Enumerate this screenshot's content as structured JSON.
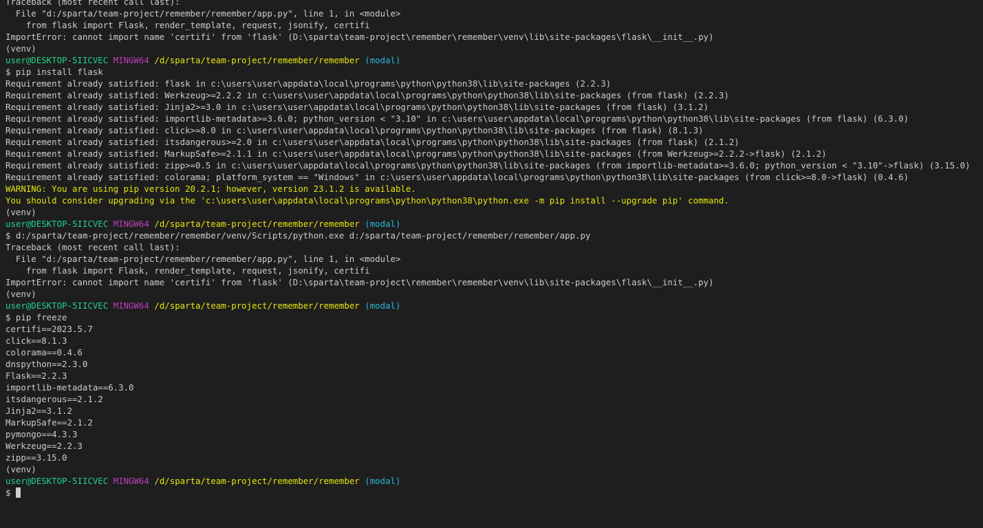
{
  "colors": {
    "background": "#1e1e1e",
    "text": "#cccccc",
    "user_host": "#23d18b",
    "shell_name": "#bc3fbc",
    "cwd": "#e5e510",
    "branch": "#29b8db",
    "warning": "#e5e510"
  },
  "lines": [
    [
      {
        "t": "Traceback (most recent call last):",
        "c": "default"
      }
    ],
    [
      {
        "t": "  File \"d:/sparta/team-project/remember/remember/app.py\", line 1, in <module>",
        "c": "default"
      }
    ],
    [
      {
        "t": "    from flask import Flask, render_template, request, jsonify, certifi",
        "c": "default"
      }
    ],
    [
      {
        "t": "ImportError: cannot import name 'certifi' from 'flask' (D:\\sparta\\team-project\\remember\\remember\\venv\\lib\\site-packages\\flask\\__init__.py)",
        "c": "default"
      }
    ],
    [
      {
        "t": "(venv)",
        "c": "default"
      }
    ],
    [
      {
        "t": "user@DESKTOP-5IICVEC",
        "c": "user"
      },
      {
        "t": " ",
        "c": "default"
      },
      {
        "t": "MINGW64",
        "c": "mingw"
      },
      {
        "t": " ",
        "c": "default"
      },
      {
        "t": "/d/sparta/team-project/remember/remember",
        "c": "path"
      },
      {
        "t": " ",
        "c": "default"
      },
      {
        "t": "(modal)",
        "c": "branch"
      }
    ],
    [
      {
        "t": "$ pip install flask",
        "c": "default"
      }
    ],
    [
      {
        "t": "Requirement already satisfied: flask in c:\\users\\user\\appdata\\local\\programs\\python\\python38\\lib\\site-packages (2.2.3)",
        "c": "default"
      }
    ],
    [
      {
        "t": "Requirement already satisfied: Werkzeug>=2.2.2 in c:\\users\\user\\appdata\\local\\programs\\python\\python38\\lib\\site-packages (from flask) (2.2.3)",
        "c": "default"
      }
    ],
    [
      {
        "t": "Requirement already satisfied: Jinja2>=3.0 in c:\\users\\user\\appdata\\local\\programs\\python\\python38\\lib\\site-packages (from flask) (3.1.2)",
        "c": "default"
      }
    ],
    [
      {
        "t": "Requirement already satisfied: importlib-metadata>=3.6.0; python_version < \"3.10\" in c:\\users\\user\\appdata\\local\\programs\\python\\python38\\lib\\site-packages (from flask) (6.3.0)",
        "c": "default"
      }
    ],
    [
      {
        "t": "Requirement already satisfied: click>=8.0 in c:\\users\\user\\appdata\\local\\programs\\python\\python38\\lib\\site-packages (from flask) (8.1.3)",
        "c": "default"
      }
    ],
    [
      {
        "t": "Requirement already satisfied: itsdangerous>=2.0 in c:\\users\\user\\appdata\\local\\programs\\python\\python38\\lib\\site-packages (from flask) (2.1.2)",
        "c": "default"
      }
    ],
    [
      {
        "t": "Requirement already satisfied: MarkupSafe>=2.1.1 in c:\\users\\user\\appdata\\local\\programs\\python\\python38\\lib\\site-packages (from Werkzeug>=2.2.2->flask) (2.1.2)",
        "c": "default"
      }
    ],
    [
      {
        "t": "Requirement already satisfied: zipp>=0.5 in c:\\users\\user\\appdata\\local\\programs\\python\\python38\\lib\\site-packages (from importlib-metadata>=3.6.0; python_version < \"3.10\"->flask) (3.15.0)",
        "c": "default"
      }
    ],
    [
      {
        "t": "Requirement already satisfied: colorama; platform_system == \"Windows\" in c:\\users\\user\\appdata\\local\\programs\\python\\python38\\lib\\site-packages (from click>=8.0->flask) (0.4.6)",
        "c": "default"
      }
    ],
    [
      {
        "t": "WARNING: You are using pip version 20.2.1; however, version 23.1.2 is available.",
        "c": "warn"
      }
    ],
    [
      {
        "t": "You should consider upgrading via the 'c:\\users\\user\\appdata\\local\\programs\\python\\python38\\python.exe -m pip install --upgrade pip' command.",
        "c": "warn"
      }
    ],
    [
      {
        "t": "(venv)",
        "c": "default"
      }
    ],
    [
      {
        "t": "user@DESKTOP-5IICVEC",
        "c": "user"
      },
      {
        "t": " ",
        "c": "default"
      },
      {
        "t": "MINGW64",
        "c": "mingw"
      },
      {
        "t": " ",
        "c": "default"
      },
      {
        "t": "/d/sparta/team-project/remember/remember",
        "c": "path"
      },
      {
        "t": " ",
        "c": "default"
      },
      {
        "t": "(modal)",
        "c": "branch"
      }
    ],
    [
      {
        "t": "$ d:/sparta/team-project/remember/remember/venv/Scripts/python.exe d:/sparta/team-project/remember/remember/app.py",
        "c": "default"
      }
    ],
    [
      {
        "t": "Traceback (most recent call last):",
        "c": "default"
      }
    ],
    [
      {
        "t": "  File \"d:/sparta/team-project/remember/remember/app.py\", line 1, in <module>",
        "c": "default"
      }
    ],
    [
      {
        "t": "    from flask import Flask, render_template, request, jsonify, certifi",
        "c": "default"
      }
    ],
    [
      {
        "t": "ImportError: cannot import name 'certifi' from 'flask' (D:\\sparta\\team-project\\remember\\remember\\venv\\lib\\site-packages\\flask\\__init__.py)",
        "c": "default"
      }
    ],
    [
      {
        "t": "(venv)",
        "c": "default"
      }
    ],
    [
      {
        "t": "user@DESKTOP-5IICVEC",
        "c": "user"
      },
      {
        "t": " ",
        "c": "default"
      },
      {
        "t": "MINGW64",
        "c": "mingw"
      },
      {
        "t": " ",
        "c": "default"
      },
      {
        "t": "/d/sparta/team-project/remember/remember",
        "c": "path"
      },
      {
        "t": " ",
        "c": "default"
      },
      {
        "t": "(modal)",
        "c": "branch"
      }
    ],
    [
      {
        "t": "$ pip freeze",
        "c": "default"
      }
    ],
    [
      {
        "t": "certifi==2023.5.7",
        "c": "default"
      }
    ],
    [
      {
        "t": "click==8.1.3",
        "c": "default"
      }
    ],
    [
      {
        "t": "colorama==0.4.6",
        "c": "default"
      }
    ],
    [
      {
        "t": "dnspython==2.3.0",
        "c": "default"
      }
    ],
    [
      {
        "t": "Flask==2.2.3",
        "c": "default"
      }
    ],
    [
      {
        "t": "importlib-metadata==6.3.0",
        "c": "default"
      }
    ],
    [
      {
        "t": "itsdangerous==2.1.2",
        "c": "default"
      }
    ],
    [
      {
        "t": "Jinja2==3.1.2",
        "c": "default"
      }
    ],
    [
      {
        "t": "MarkupSafe==2.1.2",
        "c": "default"
      }
    ],
    [
      {
        "t": "pymongo==4.3.3",
        "c": "default"
      }
    ],
    [
      {
        "t": "Werkzeug==2.2.3",
        "c": "default"
      }
    ],
    [
      {
        "t": "zipp==3.15.0",
        "c": "default"
      }
    ],
    [
      {
        "t": "(venv)",
        "c": "default"
      }
    ],
    [
      {
        "t": "user@DESKTOP-5IICVEC",
        "c": "user"
      },
      {
        "t": " ",
        "c": "default"
      },
      {
        "t": "MINGW64",
        "c": "mingw"
      },
      {
        "t": " ",
        "c": "default"
      },
      {
        "t": "/d/sparta/team-project/remember/remember",
        "c": "path"
      },
      {
        "t": " ",
        "c": "default"
      },
      {
        "t": "(modal)",
        "c": "branch"
      }
    ]
  ],
  "input_line": {
    "prompt": "$ ",
    "value": ""
  }
}
